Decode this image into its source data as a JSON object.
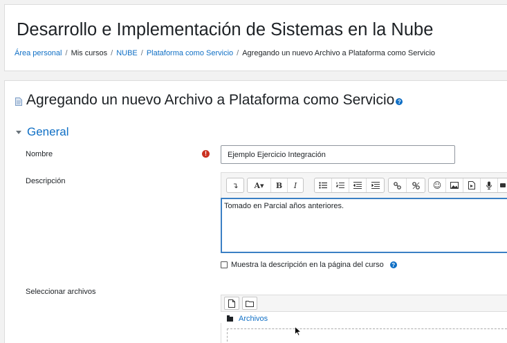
{
  "course": {
    "title": "Desarrollo e Implementación de Sistemas en la Nube"
  },
  "breadcrumb": {
    "items": [
      "Área personal",
      "Mis cursos",
      "NUBE",
      "Plataforma como Servicio",
      "Agregando un nuevo Archivo a Plataforma como Servicio"
    ],
    "separator": "/"
  },
  "page": {
    "heading": "Agregando un nuevo Archivo a Plataforma como Servicio",
    "help_icon": "question-circle-icon"
  },
  "form": {
    "section": "General",
    "name_label": "Nombre",
    "name_value": "Ejemplo Ejercicio Integración",
    "description_label": "Descripción",
    "description_value": "Tomado en Parcial años anteriores.",
    "show_description_label": "Muestra la descripción en la página del curso",
    "show_description_checked": false,
    "files_label": "Seleccionar archivos",
    "files_path": "Archivos",
    "required_icon": "exclamation-circle-icon"
  },
  "editor_toolbar": {
    "groups": [
      [
        "collapse",
        "font",
        "bold",
        "italic"
      ],
      [
        "unordered-list",
        "ordered-list",
        "outdent",
        "indent"
      ],
      [
        "link",
        "unlink"
      ],
      [
        "emoji",
        "image",
        "media",
        "record-audio",
        "record-video"
      ]
    ]
  },
  "colors": {
    "link": "#0f6fc5",
    "required": "#ca3120",
    "editor_focus": "#3a7fc4"
  }
}
